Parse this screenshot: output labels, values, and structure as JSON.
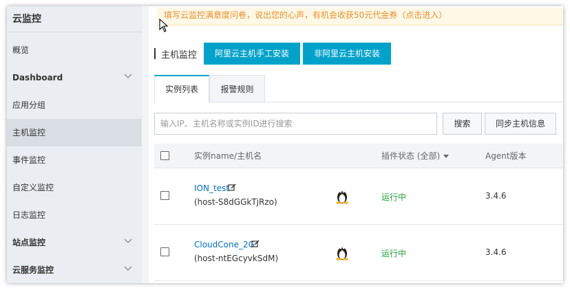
{
  "sidebar": {
    "title": "云监控",
    "items": [
      {
        "label": "概览"
      },
      {
        "label": "Dashboard"
      },
      {
        "label": "应用分组"
      },
      {
        "label": "主机监控"
      },
      {
        "label": "事件监控"
      },
      {
        "label": "自定义监控"
      },
      {
        "label": "日志监控"
      },
      {
        "label": "站点监控"
      },
      {
        "label": "云服务监控"
      }
    ]
  },
  "notice": {
    "text": "填写云监控满意度问卷，说出您的心声，有机会收获50元代金券（点击进入）"
  },
  "page": {
    "title": "主机监控",
    "btn_aliyun_install": "阿里云主机手工安装",
    "btn_non_aliyun_install": "非阿里云主机安装"
  },
  "tabs": [
    {
      "label": "实例列表",
      "active": true
    },
    {
      "label": "报警规则",
      "active": false
    }
  ],
  "search": {
    "placeholder": "输入IP、主机名称或实例ID进行搜索",
    "search_label": "搜索",
    "sync_label": "同步主机信息"
  },
  "table": {
    "columns": {
      "name": "实例name/主机名",
      "plugin_status": "插件状态 (全部)",
      "agent_version": "Agent版本"
    },
    "rows": [
      {
        "name": "ION_test",
        "host": "(host-S8dGGkTjRzo)",
        "os_icon": "linux-tux-icon",
        "status": "运行中",
        "version": "3.4.6"
      },
      {
        "name": "CloudCone_2G",
        "host": "(host-ntEGcyvkSdM)",
        "os_icon": "linux-tux-icon",
        "status": "运行中",
        "version": "3.4.6"
      }
    ]
  },
  "colors": {
    "accent": "#00a2ca",
    "notice_text": "#e8902e",
    "running": "#1e9f3a",
    "link": "#0070cc",
    "sidebar_bg": "#eaedf1"
  }
}
